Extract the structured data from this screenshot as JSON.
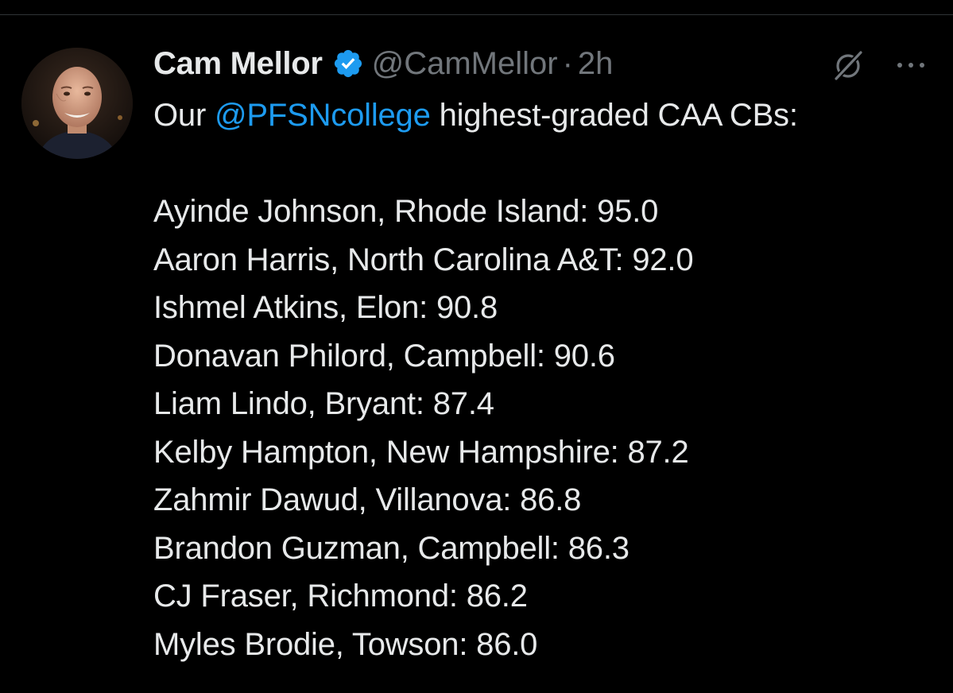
{
  "tweet": {
    "author": {
      "display_name": "Cam Mellor",
      "handle": "@CamMellor",
      "verified": true,
      "avatar_icon": "profile-photo"
    },
    "separator": "·",
    "time": "2h",
    "icons": {
      "grok": "grok-icon",
      "more": "more-options-icon"
    },
    "intro": {
      "prefix": "Our ",
      "mention": "@PFSNcollege",
      "suffix": " highest-graded CAA CBs:"
    },
    "rankings": [
      "Ayinde Johnson, Rhode Island: 95.0",
      "Aaron Harris, North Carolina A&T: 92.0",
      "Ishmel Atkins, Elon: 90.8",
      "Donavan Philord, Campbell: 90.6",
      "Liam Lindo, Bryant: 87.4",
      "Kelby Hampton, New Hampshire: 87.2",
      "Zahmir Dawud, Villanova: 86.8",
      "Brandon Guzman, Campbell: 86.3",
      "CJ Fraser, Richmond: 86.2",
      "Myles Brodie, Towson: 86.0"
    ]
  },
  "colors": {
    "background": "#000000",
    "text": "#e7e9ea",
    "muted": "#71767b",
    "link": "#1d9bf0",
    "verified_badge": "#1d9bf0"
  }
}
